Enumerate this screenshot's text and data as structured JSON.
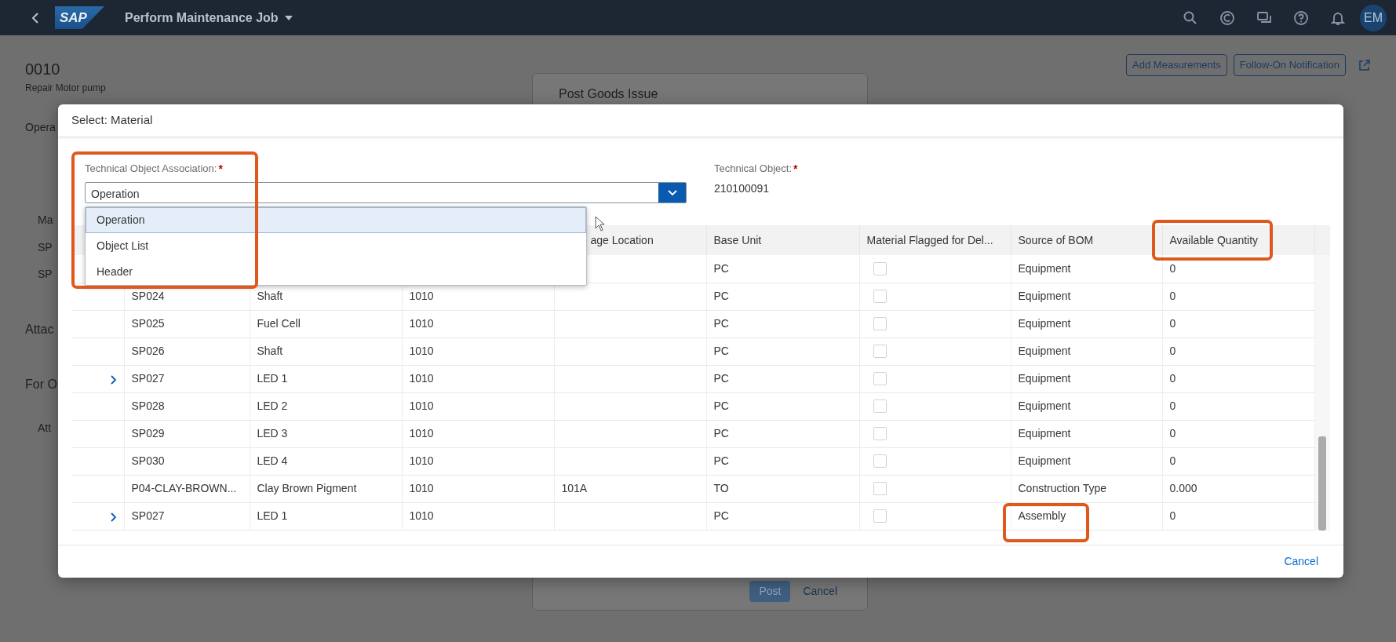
{
  "shell_bar": {
    "logo": "SAP",
    "title": "Perform Maintenance Job",
    "avatar": "EM"
  },
  "background_page": {
    "object_id": "0010",
    "object_description": "Repair Motor pump",
    "tab_cut": "Opera",
    "header_buttons": [
      "Add Measurements",
      "Follow-On Notification"
    ],
    "cut_texts": [
      {
        "kind": "table",
        "text": "Ma"
      },
      {
        "kind": "table",
        "text": "SP"
      },
      {
        "kind": "table",
        "text": "SP"
      },
      {
        "kind": "section",
        "text": "Attac"
      },
      {
        "kind": "section",
        "text": "For O"
      },
      {
        "kind": "table",
        "text": "Att"
      }
    ],
    "popover": {
      "title": "Post Goods Issue",
      "buttons": [
        "Post",
        "Cancel"
      ]
    }
  },
  "dialog": {
    "title": "Select: Material",
    "association": {
      "label": "Technical Object Association:",
      "required_mark": "*",
      "value": "Operation",
      "expanded": true,
      "options": [
        {
          "label": "Operation",
          "selected": true
        },
        {
          "label": "Object List",
          "selected": false
        },
        {
          "label": "Header",
          "selected": false
        }
      ]
    },
    "technical_object": {
      "label": "Technical Object:",
      "required_mark": "*",
      "value": "210100091"
    },
    "table": {
      "columns": [
        "age Location",
        "Base Unit",
        "Material Flagged for Del...",
        "Source of BOM",
        "Available Quantity"
      ],
      "rows": [
        {
          "expandable": false,
          "base_unit": "PC",
          "flagged": false,
          "bom_source": "Equipment",
          "available_quantity": "0"
        },
        {
          "expandable": false,
          "material": "SP024",
          "description": "Shaft",
          "plant": "1010",
          "base_unit": "PC",
          "flagged": false,
          "bom_source": "Equipment",
          "available_quantity": "0"
        },
        {
          "expandable": false,
          "material": "SP025",
          "description": "Fuel Cell",
          "plant": "1010",
          "base_unit": "PC",
          "flagged": false,
          "bom_source": "Equipment",
          "available_quantity": "0"
        },
        {
          "expandable": false,
          "material": "SP026",
          "description": "Shaft",
          "plant": "1010",
          "base_unit": "PC",
          "flagged": false,
          "bom_source": "Equipment",
          "available_quantity": "0"
        },
        {
          "expandable": true,
          "material": "SP027",
          "description": "LED 1",
          "plant": "1010",
          "base_unit": "PC",
          "flagged": false,
          "bom_source": "Equipment",
          "available_quantity": "0"
        },
        {
          "expandable": false,
          "material": "SP028",
          "description": "LED 2",
          "plant": "1010",
          "base_unit": "PC",
          "flagged": false,
          "bom_source": "Equipment",
          "available_quantity": "0"
        },
        {
          "expandable": false,
          "material": "SP029",
          "description": "LED 3",
          "plant": "1010",
          "base_unit": "PC",
          "flagged": false,
          "bom_source": "Equipment",
          "available_quantity": "0"
        },
        {
          "expandable": false,
          "material": "SP030",
          "description": "LED 4",
          "plant": "1010",
          "base_unit": "PC",
          "flagged": false,
          "bom_source": "Equipment",
          "available_quantity": "0"
        },
        {
          "expandable": false,
          "material": "P04-CLAY-BROWN...",
          "description": "Clay Brown Pigment",
          "plant": "1010",
          "storage_location": "101A",
          "base_unit": "TO",
          "flagged": false,
          "bom_source": "Construction Type",
          "available_quantity": "0.000"
        },
        {
          "expandable": true,
          "material": "SP027",
          "description": "LED 1",
          "plant": "1010",
          "base_unit": "PC",
          "flagged": false,
          "bom_source": "Assembly",
          "available_quantity": "0"
        }
      ]
    },
    "footer_buttons": [
      "Cancel"
    ]
  },
  "annotation_marks": [
    {
      "kind": "box"
    },
    {
      "kind": "box"
    },
    {
      "kind": "box"
    }
  ]
}
